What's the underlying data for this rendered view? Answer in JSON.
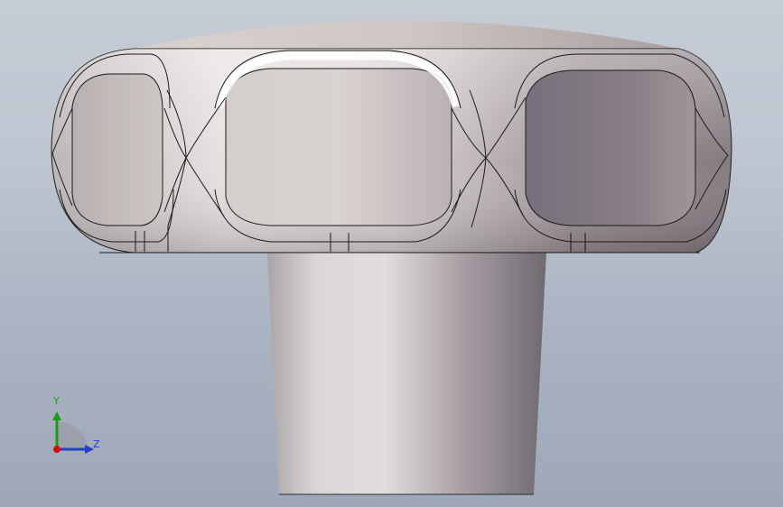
{
  "viewport": {
    "background_top": "#c6ccd6",
    "background_bottom": "#9ea8b8"
  },
  "model": {
    "part_colors": {
      "shaft_light": "#e1dcdc",
      "shaft_dark": "#6f6a70",
      "knob_light": "#efebea",
      "knob_dark": "#6e676c",
      "edge": "#1a1a1a"
    }
  },
  "triad": {
    "y_label": "Y",
    "z_label": "Z",
    "y_color": "#1e9a1e",
    "z_color": "#2040c8",
    "x_color": "#d01010",
    "icons": [
      "y-axis-arrow-icon",
      "z-axis-arrow-icon",
      "x-axis-dot-icon",
      "view-orientation-quadrant-icon"
    ]
  }
}
